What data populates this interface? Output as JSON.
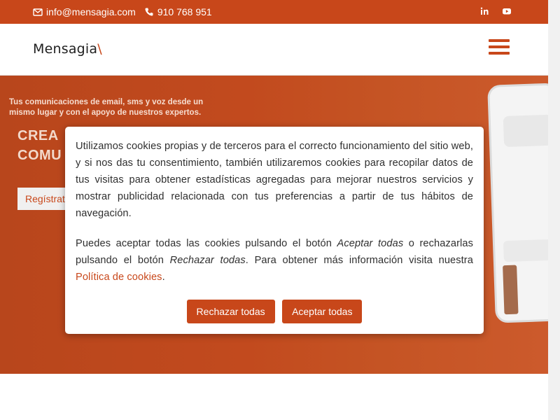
{
  "topbar": {
    "email": "info@mensagia.com",
    "phone": "910 768 951",
    "icons": [
      "envelope-icon",
      "phone-icon",
      "linkedin-icon",
      "youtube-icon"
    ]
  },
  "header": {
    "logo_text": "Mensagia",
    "logo_slash": "\\",
    "menu_icon": "hamburger-icon"
  },
  "hero": {
    "subtitle": "Tus comunicaciones de email, sms y voz desde un mismo lugar y con el apoyo de nuestros expertos.",
    "title_line1": "CREA",
    "title_line2": "COMU",
    "register_button": "Regístrat"
  },
  "cookie_modal": {
    "paragraph1": "Utilizamos cookies propias y de terceros para el correcto funcionamiento del sitio web, y si nos das tu consentimiento, también utilizaremos cookies para recopilar datos de tus visitas para obtener estadísticas agregadas para mejorar nuestros servicios y mostrar publicidad relacionada con tus preferencias a partir de tus hábitos de navegación.",
    "p2_part1": "Puedes aceptar todas las cookies pulsando el botón ",
    "p2_accept_em": "Aceptar todas",
    "p2_part2": " o rechazarlas pulsando el botón ",
    "p2_reject_em": "Rechazar todas",
    "p2_part3": ". Para obtener más información visita nuestra ",
    "policy_link": "Política de cookies",
    "p2_end": ".",
    "reject_button": "Rechazar todas",
    "accept_button": "Aceptar todas"
  },
  "colors": {
    "brand": "#c8471a",
    "white": "#ffffff"
  }
}
